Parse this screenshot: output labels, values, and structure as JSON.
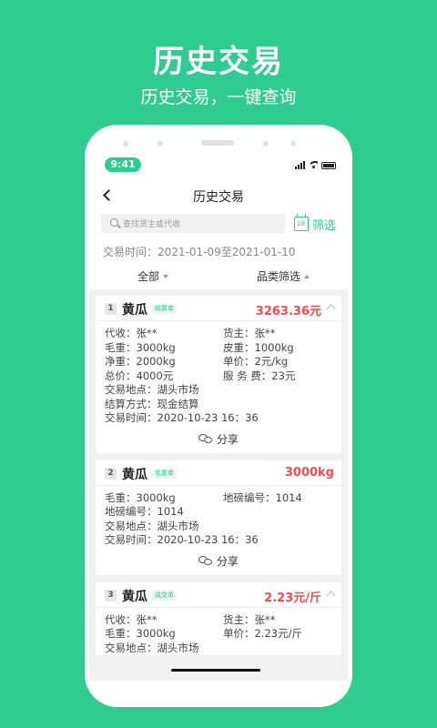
{
  "promo": {
    "title": "历史交易",
    "subtitle": "历史交易，一键查询"
  },
  "status": {
    "time": "9:41"
  },
  "nav": {
    "title": "历史交易"
  },
  "search": {
    "placeholder": "查找货主或代收"
  },
  "filter": {
    "label": "筛选",
    "calendar_day": "18"
  },
  "date_range": "交易时间：2021-01-09至2021-01-10",
  "segments": {
    "all": "全部",
    "category": "品类筛选"
  },
  "colors": {
    "brand": "#2ecc8f",
    "amount": "#f34d4d"
  },
  "icons": [
    "back-icon",
    "search-icon",
    "calendar-icon",
    "chevron-up-icon",
    "wechat-icon",
    "signal-icon",
    "wifi-icon",
    "battery-icon"
  ],
  "cards": [
    {
      "index": "1",
      "name": "黄瓜",
      "tag": "结算单",
      "amount": "3263.36元",
      "rows": [
        [
          "代收：张**",
          "货主：张**"
        ],
        [
          "毛重：3000kg",
          "皮重：1000kg"
        ],
        [
          "净重：2000kg",
          "单价：2元/kg"
        ],
        [
          "总价：4000元",
          "服 务 费：23元"
        ]
      ],
      "lines": [
        "交易地点：湖头市场",
        "结算方式：现金结算",
        "交易时间：2020-10-23 16：36"
      ],
      "share": "分享"
    },
    {
      "index": "2",
      "name": "黄瓜",
      "tag": "毛重单",
      "amount": "3000kg",
      "rows": [
        [
          "毛重：3000kg",
          "地磅编号：1014"
        ]
      ],
      "lines": [
        "地磅编号：1014",
        "交易地点：湖头市场",
        "交易时间：2020-10-23 16：36"
      ],
      "share": "分享"
    },
    {
      "index": "3",
      "name": "黄瓜",
      "tag": "成交单",
      "amount": "2.23元/斤",
      "rows": [
        [
          "代收：张**",
          "货主：张**"
        ],
        [
          "毛重：3000kg",
          "单价：2.23元/斤"
        ]
      ],
      "lines": [
        "交易地点：湖头市场"
      ]
    }
  ]
}
